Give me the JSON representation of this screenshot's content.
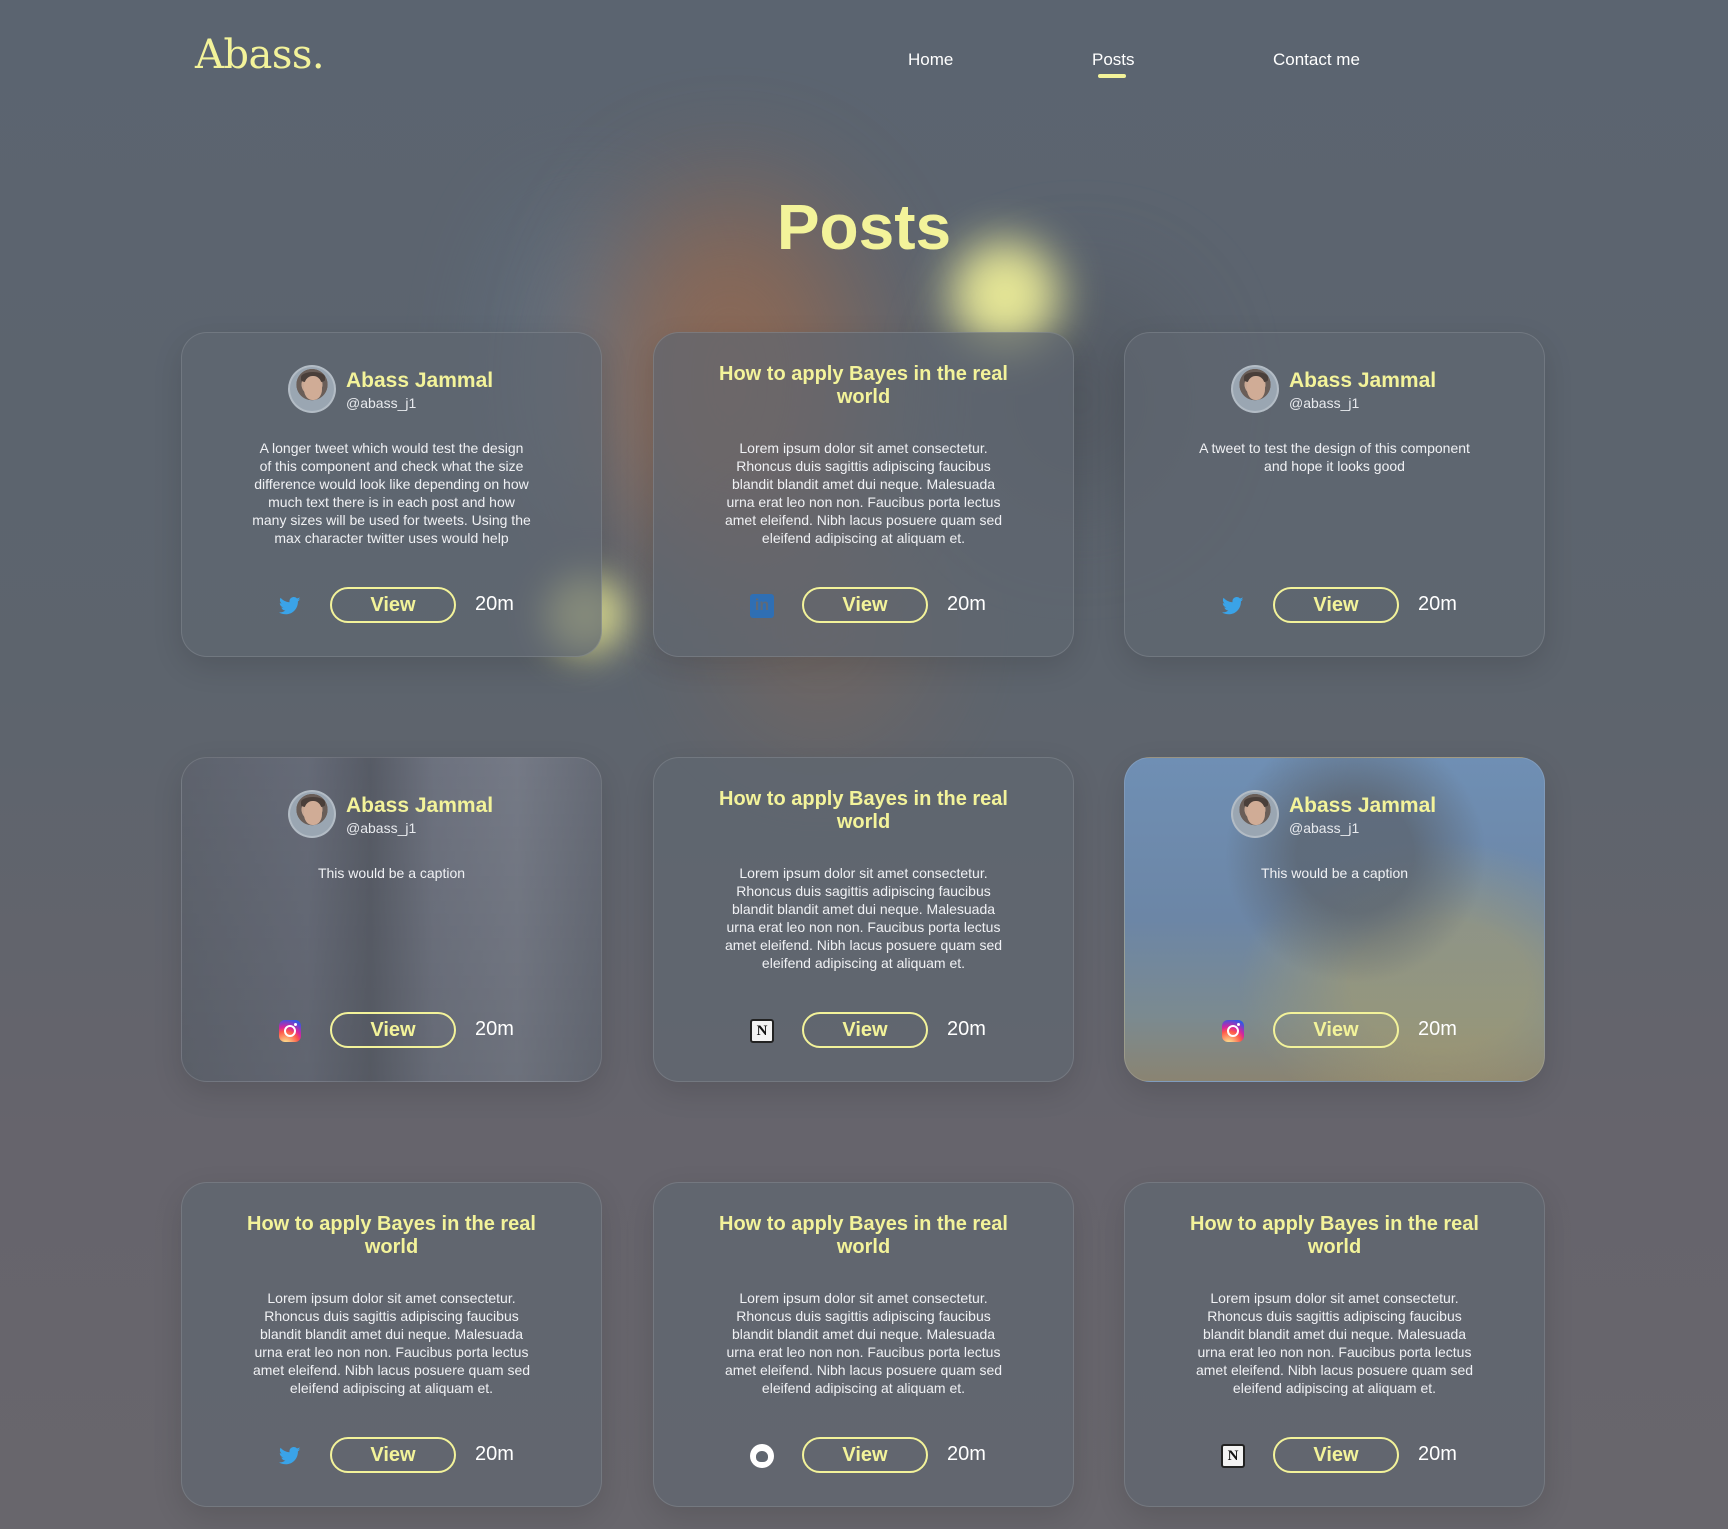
{
  "colors": {
    "accent": "#f3f39a",
    "twitter": "#3aa3e8",
    "linkedin": "#2f6fb4"
  },
  "header": {
    "logo": "Abass.",
    "nav": [
      {
        "label": "Home"
      },
      {
        "label": "Posts",
        "active": true
      },
      {
        "label": "Contact me"
      }
    ]
  },
  "page": {
    "title": "Posts"
  },
  "posts": [
    {
      "author": {
        "name": "Abass Jammal",
        "handle": "@abass_j1"
      },
      "body": "A longer tweet which would test the design of this component and check what the size difference would look like depending on how much text there is in each post and how many sizes will be used for tweets. Using the max character twitter uses would help",
      "source_icon": "twitter-icon",
      "view_label": "View",
      "time": "20m"
    },
    {
      "title": "How to apply Bayes in the real world",
      "body": "Lorem ipsum dolor sit amet consectetur. Rhoncus duis sagittis adipiscing faucibus blandit blandit amet dui neque. Malesuada urna erat leo non non. Faucibus porta lectus amet eleifend. Nibh lacus posuere quam sed eleifend adipiscing at aliquam et.",
      "source_icon": "linkedin-icon",
      "view_label": "View",
      "time": "20m"
    },
    {
      "author": {
        "name": "Abass Jammal",
        "handle": "@abass_j1"
      },
      "body": "A tweet to test the design of this component and hope it looks good",
      "source_icon": "twitter-icon",
      "view_label": "View",
      "time": "20m"
    },
    {
      "author": {
        "name": "Abass Jammal",
        "handle": "@abass_j1"
      },
      "body": "This would be a caption",
      "source_icon": "instagram-icon",
      "view_label": "View",
      "time": "20m"
    },
    {
      "title": "How to apply Bayes in the real world",
      "body": "Lorem ipsum dolor sit amet consectetur. Rhoncus duis sagittis adipiscing faucibus blandit blandit amet dui neque. Malesuada urna erat leo non non. Faucibus porta lectus amet eleifend. Nibh lacus posuere quam sed eleifend adipiscing at aliquam et.",
      "source_icon": "notion-icon",
      "view_label": "View",
      "time": "20m"
    },
    {
      "author": {
        "name": "Abass Jammal",
        "handle": "@abass_j1"
      },
      "body": "This would be a caption",
      "source_icon": "instagram-icon",
      "view_label": "View",
      "time": "20m"
    },
    {
      "title": "How to apply Bayes in the real world",
      "body": "Lorem ipsum dolor sit amet consectetur. Rhoncus duis sagittis adipiscing faucibus blandit blandit amet dui neque. Malesuada urna erat leo non non. Faucibus porta lectus amet eleifend. Nibh lacus posuere quam sed eleifend adipiscing at aliquam et.",
      "source_icon": "twitter-icon",
      "view_label": "View",
      "time": "20m"
    },
    {
      "title": "How to apply Bayes in the real world",
      "body": "Lorem ipsum dolor sit amet consectetur. Rhoncus duis sagittis adipiscing faucibus blandit blandit amet dui neque. Malesuada urna erat leo non non. Faucibus porta lectus amet eleifend. Nibh lacus posuere quam sed eleifend adipiscing at aliquam et.",
      "source_icon": "github-icon",
      "view_label": "View",
      "time": "20m"
    },
    {
      "title": "How to apply Bayes in the real world",
      "body": "Lorem ipsum dolor sit amet consectetur. Rhoncus duis sagittis adipiscing faucibus blandit blandit amet dui neque. Malesuada urna erat leo non non. Faucibus porta lectus amet eleifend. Nibh lacus posuere quam sed eleifend adipiscing at aliquam et.",
      "source_icon": "notion-icon",
      "view_label": "View",
      "time": "20m"
    }
  ]
}
